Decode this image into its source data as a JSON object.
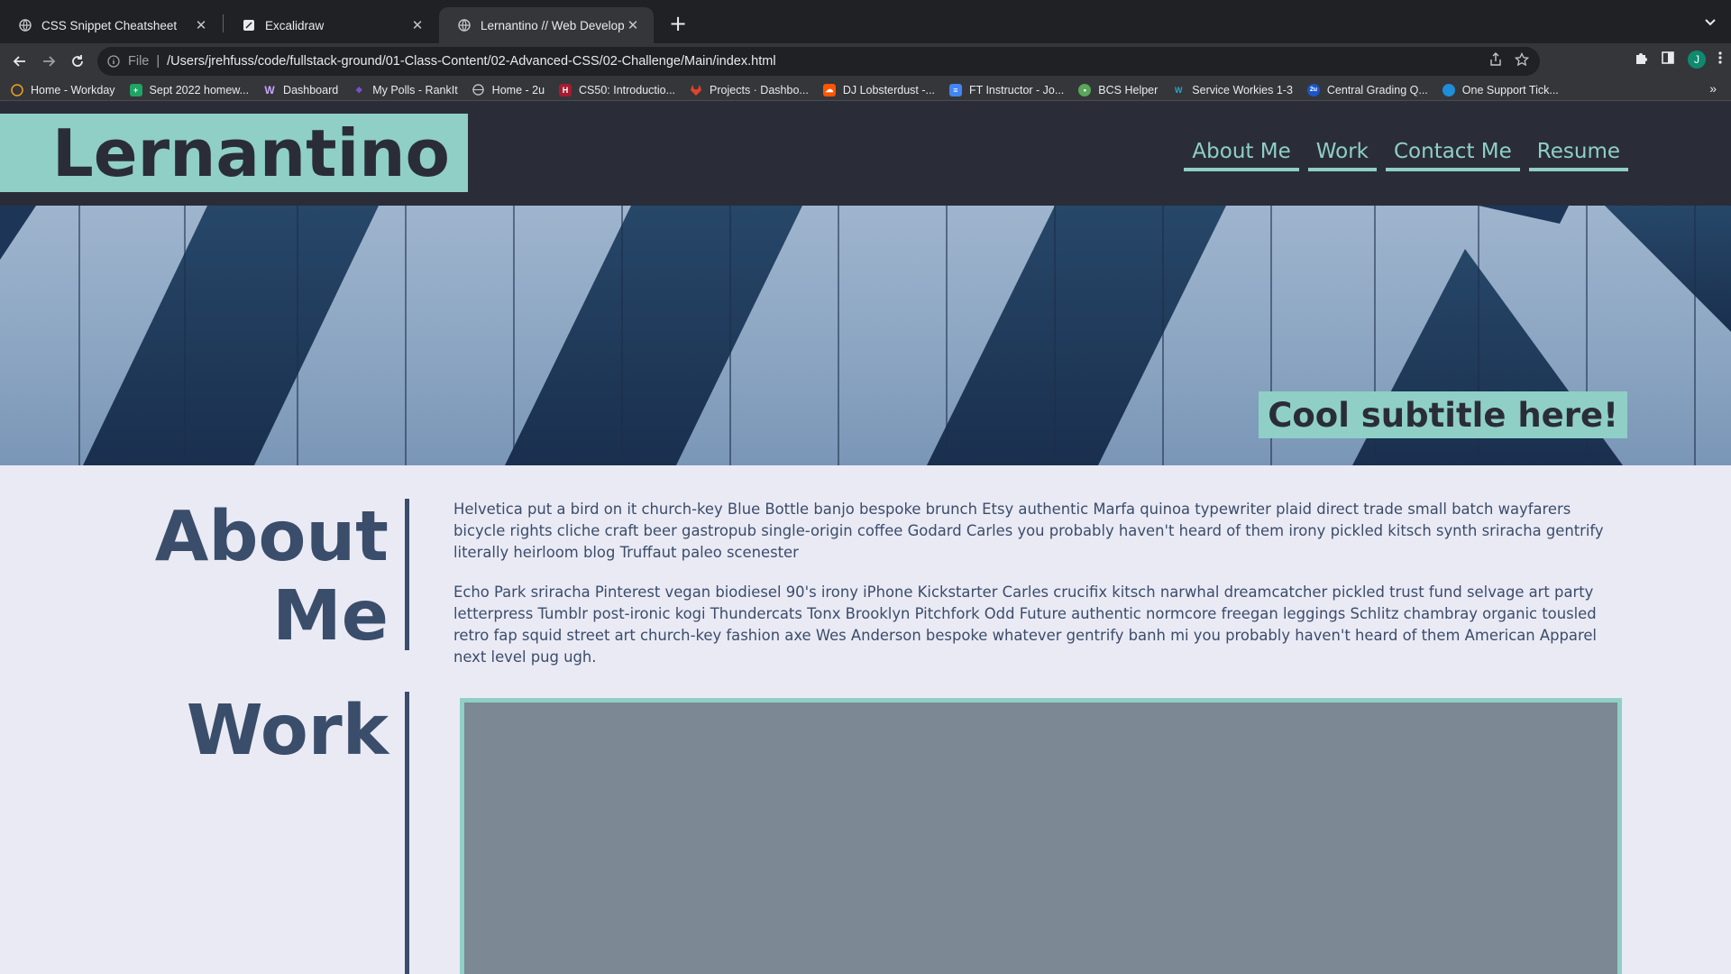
{
  "browser": {
    "tabs": [
      {
        "title": "CSS Snippet Cheatsheet",
        "icon": "globe-icon",
        "active": false
      },
      {
        "title": "Excalidraw",
        "icon": "excalidraw-icon",
        "active": false
      },
      {
        "title": "Lernantino // Web Developer",
        "icon": "globe-icon",
        "active": true
      }
    ],
    "address": {
      "scheme": "File",
      "url": "/Users/jrehfuss/code/fullstack-ground/01-Class-Content/02-Advanced-CSS/02-Challenge/Main/index.html"
    },
    "profile_initial": "J",
    "bookmarks": [
      {
        "label": "Home - Workday",
        "icon": "workday-icon",
        "color": "#f4a020"
      },
      {
        "label": "Sept 2022 homew...",
        "icon": "sheets-icon",
        "color": "#1fa463"
      },
      {
        "label": "Dashboard",
        "icon": "w-icon",
        "color": "#6b3fa0"
      },
      {
        "label": "My Polls - RankIt",
        "icon": "rankit-icon",
        "color": "#7b4fc9"
      },
      {
        "label": "Home - 2u",
        "icon": "globe-icon",
        "color": "#9aa0a6"
      },
      {
        "label": "CS50: Introductio...",
        "icon": "harvard-icon",
        "color": "#a51c30"
      },
      {
        "label": "Projects · Dashbo...",
        "icon": "gitlab-icon",
        "color": "#e2432a"
      },
      {
        "label": "DJ Lobsterdust -...",
        "icon": "soundcloud-icon",
        "color": "#ff5500"
      },
      {
        "label": "FT Instructor - Jo...",
        "icon": "docs-icon",
        "color": "#4285f4"
      },
      {
        "label": "BCS Helper",
        "icon": "frog-icon",
        "color": "#5aa55a"
      },
      {
        "label": "Service Workies 1-3",
        "icon": "sw-icon",
        "color": "#2aa6c9"
      },
      {
        "label": "Central Grading Q...",
        "icon": "2u-icon",
        "color": "#1a56c9"
      },
      {
        "label": "One Support Tick...",
        "icon": "salesforce-icon",
        "color": "#1e8ed9"
      }
    ]
  },
  "site": {
    "logo": "Lernantino",
    "nav": [
      "About Me",
      "Work",
      "Contact Me",
      "Resume"
    ],
    "subtitle": "Cool subtitle here!",
    "about": {
      "title_line1": "About",
      "title_line2": "Me",
      "paragraphs": [
        "Helvetica put a bird on it church-key Blue Bottle banjo bespoke brunch Etsy authentic Marfa quinoa typewriter plaid direct trade small batch wayfarers bicycle rights cliche craft beer gastropub single-origin coffee Godard Carles you probably haven't heard of them irony pickled kitsch synth sriracha gentrify literally heirloom blog Truffaut paleo scenester",
        "Echo Park sriracha Pinterest vegan biodiesel 90's irony iPhone Kickstarter Carles crucifix kitsch narwhal dreamcatcher pickled trust fund selvage art party letterpress Tumblr post-ironic kogi Thundercats Tonx Brooklyn Pitchfork Odd Future authentic normcore freegan leggings Schlitz chambray organic tousled retro fap squid street art church-key fashion axe Wes Anderson bespoke whatever gentrify banh mi you probably haven't heard of them American Apparel next level pug ugh."
      ]
    },
    "work": {
      "title": "Work"
    },
    "colors": {
      "accent": "#8fcfc6",
      "header_bg": "#2a2d38",
      "text": "#3a4d6a",
      "page_bg": "#eaeaf5"
    }
  }
}
